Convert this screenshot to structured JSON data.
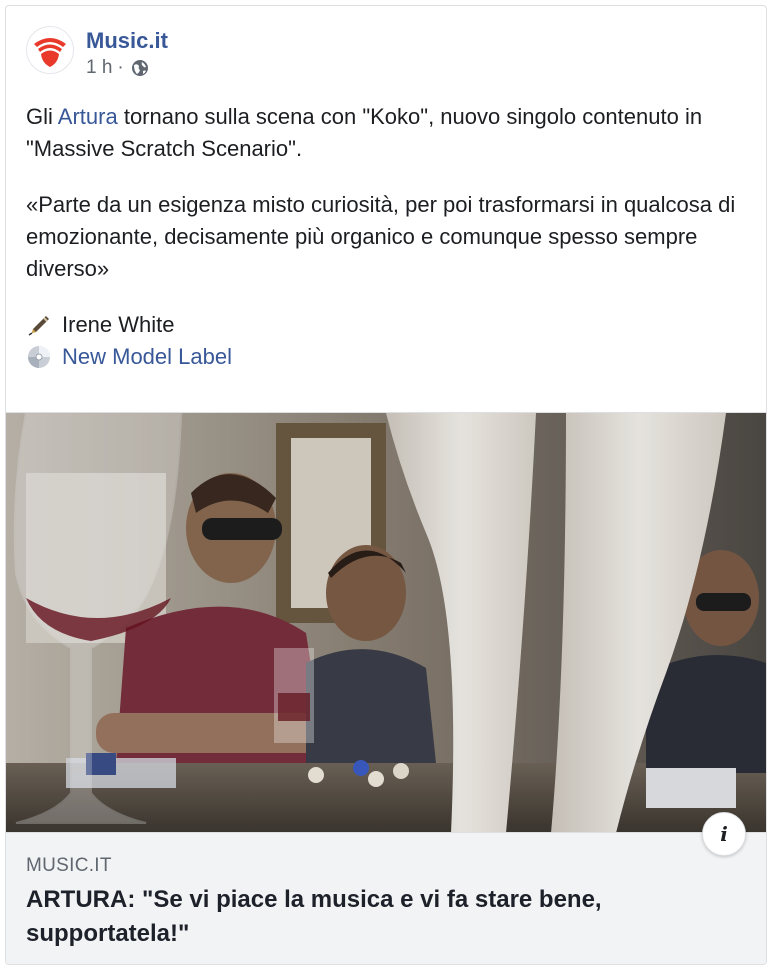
{
  "post": {
    "page_name": "Music.it",
    "time": "1 h",
    "separator": "·",
    "text_before_link": "Gli ",
    "band_link": "Artura",
    "text_after_link": " tornano sulla scena con \"Koko\", nuovo singolo contenuto in \"Massive Scratch Scenario\".",
    "quote": "«Parte da un esigenza misto curiosità, per poi trasformarsi in qualcosa di emozionante, decisamente più organico e comunque spesso sempre diverso»",
    "credit_person": "Irene White",
    "credit_label": "New Model Label"
  },
  "link_preview": {
    "domain": "MUSIC.IT",
    "title": "ARTURA: \"Se vi piace la musica e vi fa stare bene, supportatela!\"",
    "info_icon": "i"
  },
  "colors": {
    "link": "#385898",
    "brand_red": "#e8392b"
  },
  "icons": [
    "music-it-logo",
    "globe-icon",
    "pen-icon",
    "disc-icon",
    "info-icon"
  ]
}
